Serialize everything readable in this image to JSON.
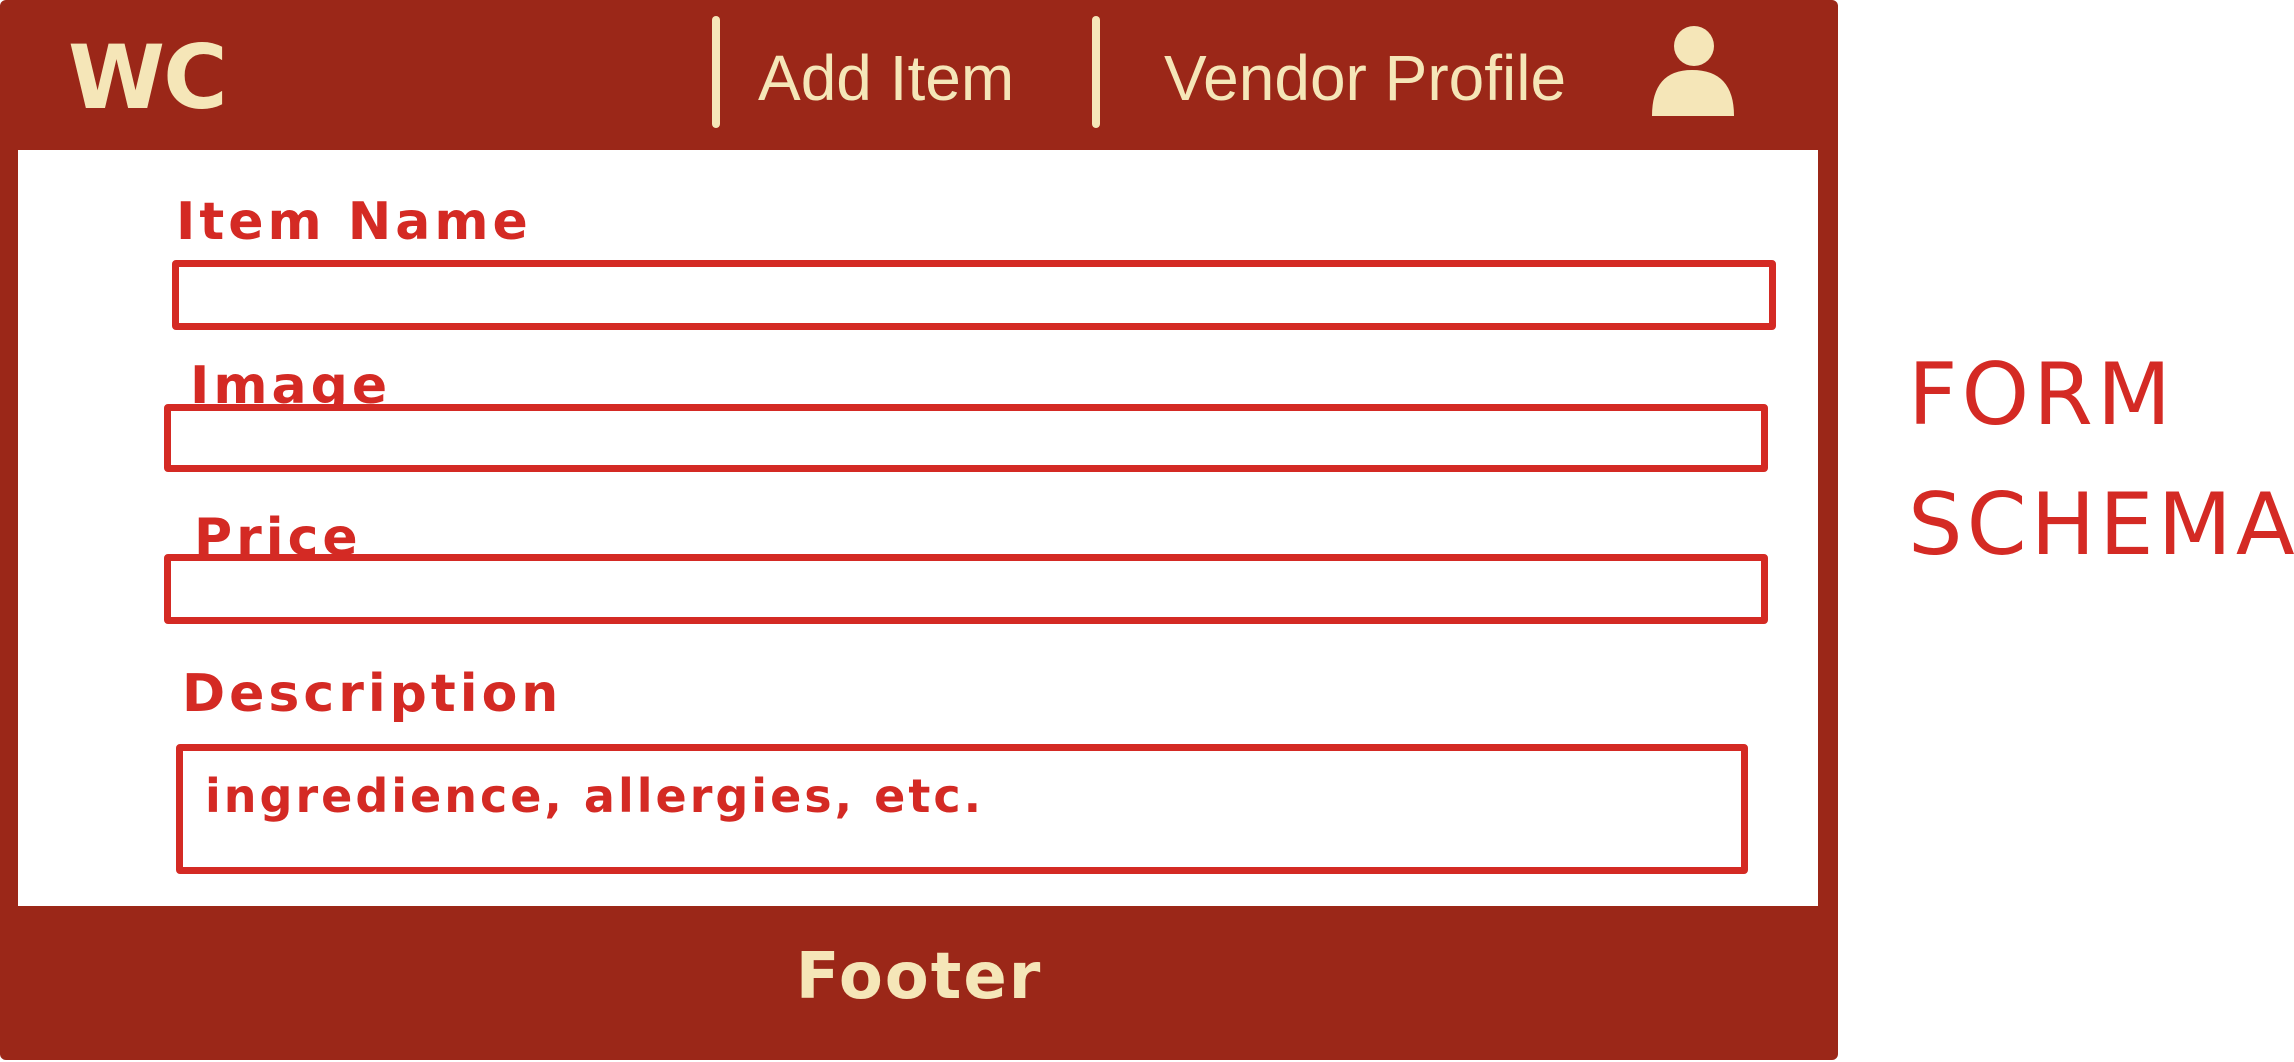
{
  "header": {
    "logo_text": "WC",
    "nav": [
      {
        "label": "Add Item"
      },
      {
        "label": "Vendor Profile"
      }
    ]
  },
  "form": {
    "fields": [
      {
        "label": "Item Name",
        "value": "",
        "placeholder": ""
      },
      {
        "label": "Image",
        "value": "",
        "placeholder": ""
      },
      {
        "label": "Price",
        "value": "",
        "placeholder": ""
      },
      {
        "label": "Description",
        "value": "",
        "placeholder": "ingredience, allergies, etc."
      }
    ]
  },
  "footer": {
    "text": "Footer"
  },
  "annotation": {
    "line1": "FORM",
    "line2": "SCHEMA"
  },
  "icons": {
    "profile": "user-profile-icon"
  },
  "colors": {
    "header_bg": "#9b2718",
    "accent_cream": "#f5e6b8",
    "form_red": "#d42a24"
  }
}
